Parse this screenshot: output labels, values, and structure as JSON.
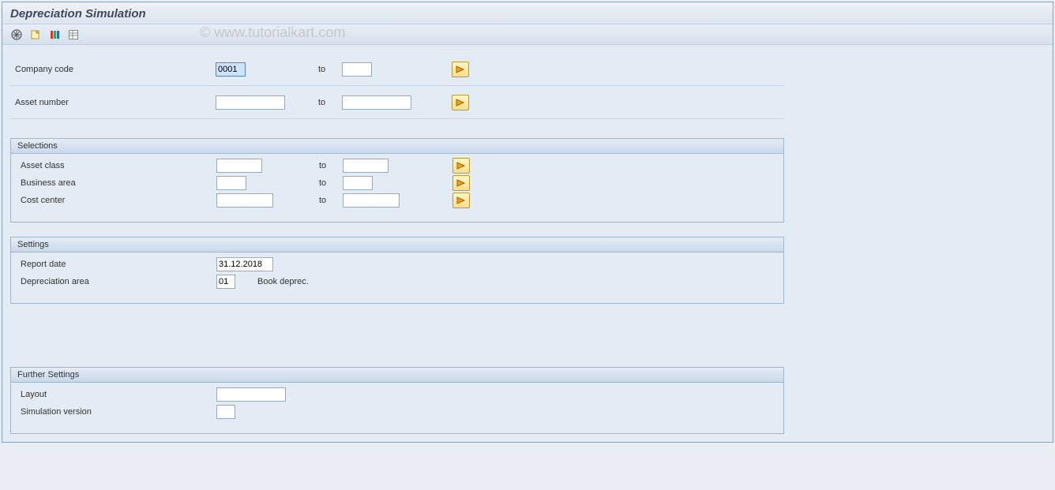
{
  "title": "Depreciation Simulation",
  "watermark": "© www.tutorialkart.com",
  "toolbar": {
    "execute_icon": "execute",
    "variant_icon": "get-variant",
    "select_icon": "select-all",
    "dynamic_icon": "dynamic-selections"
  },
  "labels": {
    "company_code": "Company code",
    "asset_number": "Asset number",
    "to": "to"
  },
  "values": {
    "company_code_from": "0001",
    "company_code_to": "",
    "asset_number_from": "",
    "asset_number_to": ""
  },
  "group_selections": {
    "title": "Selections",
    "rows": {
      "asset_class": {
        "label": "Asset class",
        "from": "",
        "to": ""
      },
      "business_area": {
        "label": "Business area",
        "from": "",
        "to": ""
      },
      "cost_center": {
        "label": "Cost center",
        "from": "",
        "to": ""
      }
    }
  },
  "group_settings": {
    "title": "Settings",
    "report_date_label": "Report date",
    "report_date": "31.12.2018",
    "depr_area_label": "Depreciation area",
    "depr_area": "01",
    "depr_area_text": "Book deprec."
  },
  "group_further": {
    "title": "Further Settings",
    "layout_label": "Layout",
    "layout": "",
    "sim_version_label": "Simulation version",
    "sim_version": ""
  }
}
